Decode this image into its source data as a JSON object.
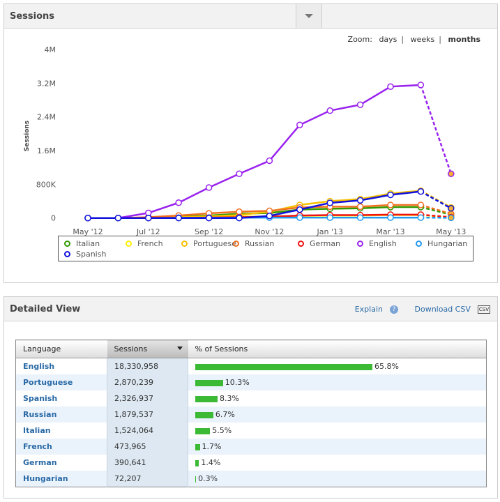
{
  "sessions_panel": {
    "title": "Sessions",
    "dropdown_icon": "triangle-down-icon",
    "zoom": {
      "label": "Zoom:",
      "options": [
        "days",
        "weeks",
        "months"
      ],
      "selected": "months"
    }
  },
  "chart_data": {
    "type": "line",
    "ylabel": "Sessions",
    "ylim": [
      0,
      4000000
    ],
    "yticks": [
      "0",
      "800K",
      "1.6M",
      "2.4M",
      "3.2M",
      "4M"
    ],
    "ytick_values": [
      0,
      800000,
      1600000,
      2400000,
      3200000,
      4000000
    ],
    "x": [
      "May '12",
      "Jun '12",
      "Jul '12",
      "Aug '12",
      "Sep '12",
      "Oct '12",
      "Nov '12",
      "Dec '12",
      "Jan '13",
      "Feb '13",
      "Mar '13",
      "Apr '13",
      "May '13"
    ],
    "xticks": [
      "May '12",
      "Jul '12",
      "Sep '12",
      "Nov '12",
      "Jan '13",
      "Mar '13",
      "May '13"
    ],
    "last_segment_dashed": true,
    "grid": false,
    "legend_placement": "bottom",
    "series": [
      {
        "name": "Italian",
        "color": "#339900",
        "values": [
          0,
          0,
          10000,
          30000,
          60000,
          100000,
          120000,
          200000,
          220000,
          230000,
          260000,
          260000,
          80000
        ]
      },
      {
        "name": "French",
        "color": "#ffee00",
        "values": [
          0,
          0,
          0,
          10000,
          20000,
          30000,
          40000,
          50000,
          60000,
          60000,
          70000,
          70000,
          20000
        ]
      },
      {
        "name": "Portuguese",
        "color": "#f5c000",
        "values": [
          0,
          0,
          0,
          20000,
          40000,
          70000,
          150000,
          310000,
          400000,
          450000,
          580000,
          650000,
          250000
        ]
      },
      {
        "name": "Russian",
        "color": "#f07020",
        "values": [
          0,
          0,
          20000,
          60000,
          110000,
          150000,
          170000,
          250000,
          270000,
          270000,
          310000,
          310000,
          100000
        ]
      },
      {
        "name": "German",
        "color": "#ee1111",
        "values": [
          0,
          0,
          0,
          5000,
          10000,
          20000,
          30000,
          60000,
          70000,
          70000,
          80000,
          80000,
          20000
        ]
      },
      {
        "name": "English",
        "color": "#9922ee",
        "values": [
          0,
          0,
          121000,
          364000,
          723000,
          1050000,
          1360000,
          2210000,
          2550000,
          2690000,
          3120000,
          3160000,
          1050000
        ]
      },
      {
        "name": "Hungarian",
        "color": "#2299ee",
        "values": [
          0,
          0,
          0,
          5000,
          5000,
          8000,
          10000,
          10000,
          10000,
          10000,
          10000,
          10000,
          5000
        ]
      },
      {
        "name": "Spanish",
        "color": "#1111dd",
        "values": [
          0,
          0,
          0,
          0,
          0,
          0,
          50000,
          200000,
          360000,
          420000,
          550000,
          630000,
          230000
        ]
      }
    ]
  },
  "detailed": {
    "title": "Detailed View",
    "explain": "Explain",
    "explain_icon": "help-icon",
    "download": "Download CSV",
    "download_icon": "csv-icon",
    "columns": [
      "Language",
      "Sessions",
      "% of Sessions"
    ],
    "rows": [
      {
        "language": "English",
        "sessions": "18,330,958",
        "pct": 65.8,
        "pct_label": "65.8%"
      },
      {
        "language": "Portuguese",
        "sessions": "2,870,239",
        "pct": 10.3,
        "pct_label": "10.3%"
      },
      {
        "language": "Spanish",
        "sessions": "2,326,937",
        "pct": 8.3,
        "pct_label": "8.3%"
      },
      {
        "language": "Russian",
        "sessions": "1,879,537",
        "pct": 6.7,
        "pct_label": "6.7%"
      },
      {
        "language": "Italian",
        "sessions": "1,524,064",
        "pct": 5.5,
        "pct_label": "5.5%"
      },
      {
        "language": "French",
        "sessions": "473,965",
        "pct": 1.7,
        "pct_label": "1.7%"
      },
      {
        "language": "German",
        "sessions": "390,641",
        "pct": 1.4,
        "pct_label": "1.4%"
      },
      {
        "language": "Hungarian",
        "sessions": "72,207",
        "pct": 0.3,
        "pct_label": "0.3%"
      }
    ],
    "bar_color": "#3cb935"
  }
}
